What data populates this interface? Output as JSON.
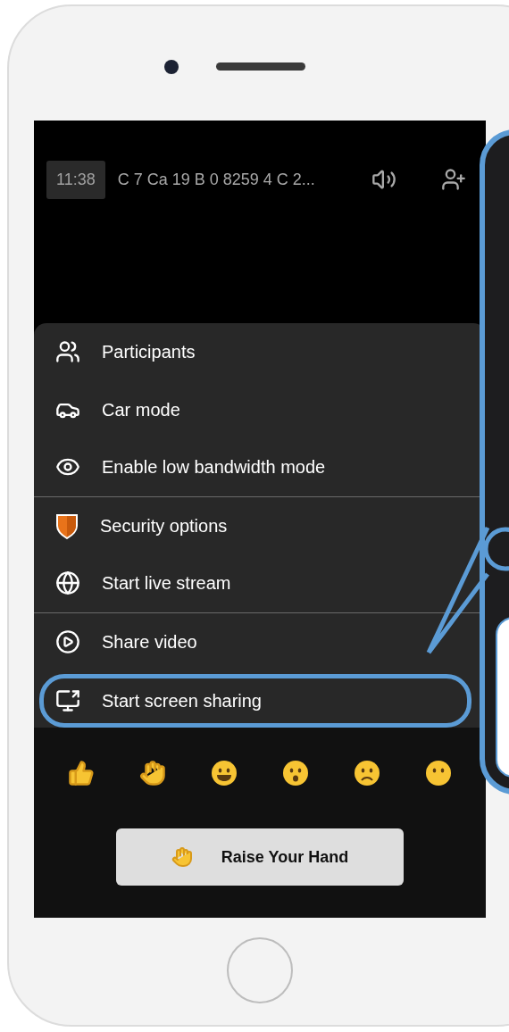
{
  "top_bar": {
    "time": "11:38",
    "title": "C 7 Ca 19 B 0 8259 4 C 2..."
  },
  "menu": {
    "groups": [
      [
        {
          "label": "Participants",
          "highlighted": false
        },
        {
          "label": "Car mode",
          "highlighted": false
        },
        {
          "label": "Enable low bandwidth mode",
          "highlighted": false
        }
      ],
      [
        {
          "label": "Security options",
          "highlighted": false
        },
        {
          "label": "Start live stream",
          "highlighted": false
        }
      ],
      [
        {
          "label": "Share video",
          "highlighted": false
        },
        {
          "label": "Start screen sharing",
          "highlighted": true
        }
      ]
    ]
  },
  "raise_hand_button": {
    "label": "Raise Your Hand"
  }
}
